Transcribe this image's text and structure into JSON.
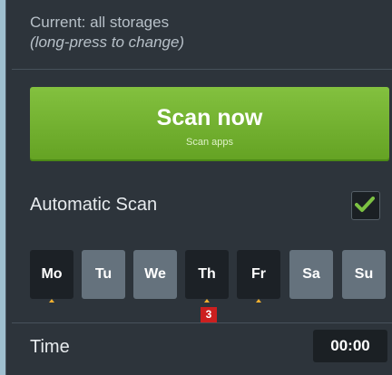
{
  "storage": {
    "current": "Current: all storages",
    "hint": "(long-press to change)"
  },
  "scan_button": {
    "label": "Scan now",
    "sublabel": "Scan apps"
  },
  "automatic_scan": {
    "label": "Automatic Scan",
    "checked": true,
    "check_color": "#7cc242"
  },
  "days": [
    {
      "label": "Mo",
      "selected": true
    },
    {
      "label": "Tu",
      "selected": false
    },
    {
      "label": "We",
      "selected": false
    },
    {
      "label": "Th",
      "selected": true
    },
    {
      "label": "Fr",
      "selected": true
    },
    {
      "label": "Sa",
      "selected": false
    },
    {
      "label": "Su",
      "selected": false
    }
  ],
  "badge": {
    "number": "3"
  },
  "time": {
    "label": "Time",
    "value": "00:00"
  }
}
